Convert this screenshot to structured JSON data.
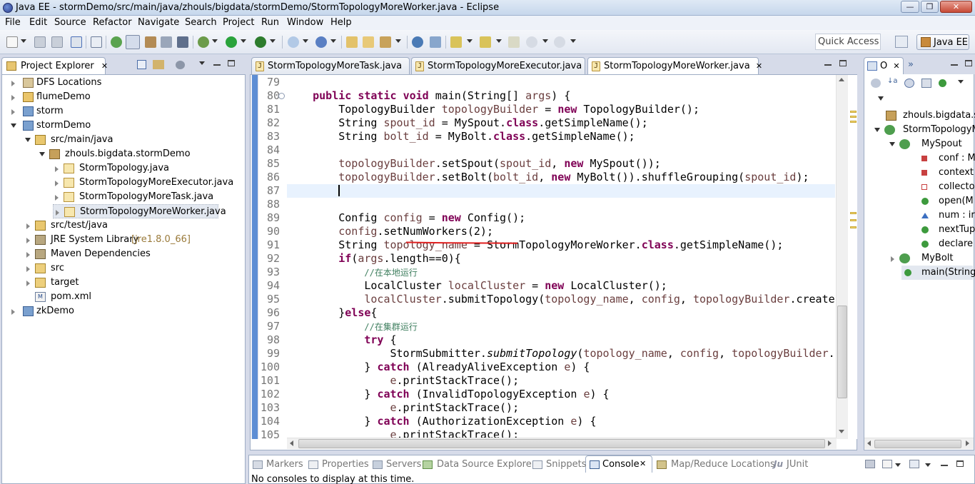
{
  "window": {
    "title": "Java EE - stormDemo/src/main/java/zhouls/bigdata/stormDemo/StormTopologyMoreWorker.java - Eclipse"
  },
  "menu": [
    "File",
    "Edit",
    "Source",
    "Refactor",
    "Navigate",
    "Search",
    "Project",
    "Run",
    "Window",
    "Help"
  ],
  "toolbar": {
    "quick_access": "Quick Access",
    "perspective": "Java EE"
  },
  "project_explorer": {
    "tab_label": "Project Explorer",
    "tree": [
      {
        "label": "DFS Locations"
      },
      {
        "label": "flumeDemo"
      },
      {
        "label": "storm"
      },
      {
        "label": "stormDemo"
      },
      {
        "label": "src/main/java"
      },
      {
        "label": "zhouls.bigdata.stormDemo"
      },
      {
        "label": "StormTopology.java"
      },
      {
        "label": "StormTopologyMoreExecutor.java"
      },
      {
        "label": "StormTopologyMoreTask.java"
      },
      {
        "label": "StormTopologyMoreWorker.java"
      },
      {
        "label": "src/test/java"
      },
      {
        "label": "JRE System Library",
        "decoration": "[jre1.8.0_66]"
      },
      {
        "label": "Maven Dependencies"
      },
      {
        "label": "src"
      },
      {
        "label": "target"
      },
      {
        "label": "pom.xml"
      },
      {
        "label": "zkDemo"
      }
    ]
  },
  "editor": {
    "tabs": [
      {
        "label": "StormTopologyMoreTask.java"
      },
      {
        "label": "StormTopologyMoreExecutor.java"
      },
      {
        "label": "StormTopologyMoreWorker.java",
        "active": true
      }
    ],
    "lines": [
      {
        "n": "79",
        "html": ""
      },
      {
        "n": "80",
        "html": "    <span class='kw'>public</span> <span class='kw'>static</span> <span class='kw'>void</span> main(String[] <span class='fd'>args</span>) {"
      },
      {
        "n": "81",
        "html": "        TopologyBuilder <span class='fd'>topologyBuilder</span> = <span class='kw'>new</span> TopologyBuilder();"
      },
      {
        "n": "82",
        "html": "        String <span class='fd'>spout_id</span> = MySpout.<span class='kw'>class</span>.getSimpleName();"
      },
      {
        "n": "83",
        "html": "        String <span class='fd'>bolt_id</span> = MyBolt.<span class='kw'>class</span>.getSimpleName();"
      },
      {
        "n": "84",
        "html": ""
      },
      {
        "n": "85",
        "html": "        <span class='fd'>topologyBuilder</span>.setSpout(<span class='fd'>spout_id</span>, <span class='kw'>new</span> MySpout());"
      },
      {
        "n": "86",
        "html": "        <span class='fd'>topologyBuilder</span>.setBolt(<span class='fd'>bolt_id</span>, <span class='kw'>new</span> MyBolt()).shuffleGrouping(<span class='fd'>spout_id</span>);"
      },
      {
        "n": "87",
        "html": "",
        "highlight": true
      },
      {
        "n": "88",
        "html": ""
      },
      {
        "n": "89",
        "html": "        Config <span class='fd'>config</span> = <span class='kw'>new</span> Config();"
      },
      {
        "n": "90",
        "html": "        <span class='fd'>config</span>.setNumWorkers(2);"
      },
      {
        "n": "91",
        "html": "        String <span class='fd'>topology_name</span> = StormTopologyMoreWorker.<span class='kw'>class</span>.getSimpleName();"
      },
      {
        "n": "92",
        "html": "        <span class='kw'>if</span>(<span class='fd'>args</span>.length==0){"
      },
      {
        "n": "93",
        "html": "            <span class='cm'>//在本地运行</span>"
      },
      {
        "n": "94",
        "html": "            LocalCluster <span class='fd'>localCluster</span> = <span class='kw'>new</span> LocalCluster();"
      },
      {
        "n": "95",
        "html": "            <span class='fd'>localCluster</span>.submitTopology(<span class='fd'>topology_name</span>, <span class='fd'>config</span>, <span class='fd'>topologyBuilder</span>.createT"
      },
      {
        "n": "96",
        "html": "        }<span class='kw'>else</span>{"
      },
      {
        "n": "97",
        "html": "            <span class='cm'>//在集群运行</span>"
      },
      {
        "n": "98",
        "html": "            <span class='kw'>try</span> {"
      },
      {
        "n": "99",
        "html": "                StormSubmitter.<span class='it'>submitTopology</span>(<span class='fd'>topology_name</span>, <span class='fd'>config</span>, <span class='fd'>topologyBuilder</span>.c"
      },
      {
        "n": "100",
        "html": "            } <span class='kw'>catch</span> (AlreadyAliveException <span class='fd'>e</span>) {"
      },
      {
        "n": "101",
        "html": "                <span class='fd'>e</span>.printStackTrace();"
      },
      {
        "n": "102",
        "html": "            } <span class='kw'>catch</span> (InvalidTopologyException <span class='fd'>e</span>) {"
      },
      {
        "n": "103",
        "html": "                <span class='fd'>e</span>.printStackTrace();"
      },
      {
        "n": "104",
        "html": "            } <span class='kw'>catch</span> (AuthorizationException <span class='fd'>e</span>) {"
      },
      {
        "n": "105",
        "html": "                <span class='fd'>e</span>.printStackTrace();"
      }
    ]
  },
  "outline": {
    "tab_label": "O",
    "items": [
      {
        "label": "zhouls.bigdata.s"
      },
      {
        "label": "StormTopologyM"
      },
      {
        "label": "MySpout"
      },
      {
        "label": "conf : M"
      },
      {
        "label": "context"
      },
      {
        "label": "collecto"
      },
      {
        "label": "open(M"
      },
      {
        "label": "num : ir"
      },
      {
        "label": "nextTup"
      },
      {
        "label": "declare"
      },
      {
        "label": "MyBolt"
      },
      {
        "label": "main(String["
      }
    ]
  },
  "bottom_panel": {
    "tabs": [
      "Markers",
      "Properties",
      "Servers",
      "Data Source Explorer",
      "Snippets",
      "Console",
      "Map/Reduce Locations",
      "JUnit"
    ],
    "active_tab": "Console",
    "message": "No consoles to display at this time."
  },
  "colors": {
    "keyword": "#7f0055",
    "field": "#6a3e3e",
    "comment": "#3f7f5f",
    "current_line": "#e8f2fe",
    "annotation_underline": "#e02020"
  }
}
